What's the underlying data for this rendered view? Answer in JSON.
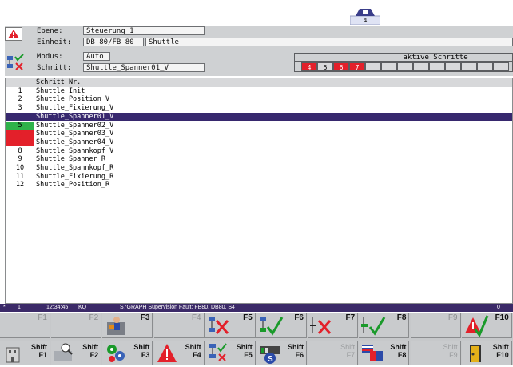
{
  "top_icon": {
    "label": "4"
  },
  "info": {
    "ebene_label": "Ebene:",
    "ebene_value": "Steuerung_1",
    "einheit_label": "Einheit:",
    "einheit_value1": "DB 80/FB 80",
    "einheit_value2": "Shuttle",
    "modus_label": "Modus:",
    "modus_value": "Auto",
    "schritt_label": "Schritt:",
    "schritt_value": "Shuttle_Spanner01_V"
  },
  "active_steps": {
    "title": "aktive Schritte",
    "cells": [
      {
        "label": "4",
        "active": true
      },
      {
        "label": "5",
        "active": false
      },
      {
        "label": "6",
        "active": true
      },
      {
        "label": "7",
        "active": true
      },
      {
        "label": "",
        "active": false
      },
      {
        "label": "",
        "active": false
      },
      {
        "label": "",
        "active": false
      },
      {
        "label": "",
        "active": false
      },
      {
        "label": "",
        "active": false
      },
      {
        "label": "",
        "active": false
      },
      {
        "label": "",
        "active": false
      },
      {
        "label": "",
        "active": false
      },
      {
        "label": "",
        "active": false
      }
    ]
  },
  "list": {
    "header": "Schritt Nr.",
    "rows": [
      {
        "num": "1",
        "name": "Shuttle_Init",
        "state": "normal"
      },
      {
        "num": "2",
        "name": "Shuttle_Position_V",
        "state": "normal"
      },
      {
        "num": "3",
        "name": "Shuttle_Fixierung_V",
        "state": "normal"
      },
      {
        "num": "4",
        "name": "Shuttle_Spanner01_V",
        "state": "selected"
      },
      {
        "num": "5",
        "name": "Shuttle_Spanner02_V",
        "state": "green"
      },
      {
        "num": "6",
        "name": "Shuttle_Spanner03_V",
        "state": "red"
      },
      {
        "num": "7",
        "name": "Shuttle_Spanner04_V",
        "state": "red"
      },
      {
        "num": "8",
        "name": "Shuttle_Spannkopf_V",
        "state": "normal"
      },
      {
        "num": "9",
        "name": "Shuttle_Spanner_R",
        "state": "normal"
      },
      {
        "num": "10",
        "name": "Shuttle_Spannkopf_R",
        "state": "normal"
      },
      {
        "num": "11",
        "name": "Shuttle_Fixierung_R",
        "state": "normal"
      },
      {
        "num": "12",
        "name": "Shuttle_Position_R",
        "state": "normal"
      }
    ]
  },
  "status": {
    "flag": "*",
    "count": "1",
    "time": "12:34:45",
    "code": "KQ",
    "message": "S7GRAPH Supervision Fault: FB80, DB80, S4",
    "right": "0"
  },
  "fkeys_row1": [
    {
      "label": "F1",
      "enabled": false,
      "icon": ""
    },
    {
      "label": "F2",
      "enabled": false,
      "icon": ""
    },
    {
      "label": "F3",
      "enabled": true,
      "icon": "operator-machine-icon"
    },
    {
      "label": "F4",
      "enabled": false,
      "icon": ""
    },
    {
      "label": "F5",
      "enabled": true,
      "icon": "step-cancel-icon"
    },
    {
      "label": "F6",
      "enabled": true,
      "icon": "step-confirm-icon"
    },
    {
      "label": "F7",
      "enabled": true,
      "icon": "transition-cancel-icon"
    },
    {
      "label": "F8",
      "enabled": true,
      "icon": "transition-confirm-icon"
    },
    {
      "label": "F9",
      "enabled": false,
      "icon": ""
    },
    {
      "label": "F10",
      "enabled": true,
      "icon": "alarm-acknowledge-icon"
    }
  ],
  "fkeys_row2": [
    {
      "l1": "Shift",
      "l2": "F1",
      "enabled": true,
      "icon": "building-icon"
    },
    {
      "l1": "Shift",
      "l2": "F2",
      "enabled": true,
      "icon": "zoom-tool-icon"
    },
    {
      "l1": "Shift",
      "l2": "F3",
      "enabled": true,
      "icon": "gears-icon"
    },
    {
      "l1": "Shift",
      "l2": "F4",
      "enabled": true,
      "icon": "warning-icon"
    },
    {
      "l1": "Shift",
      "l2": "F5",
      "enabled": true,
      "icon": "step-structure-icon"
    },
    {
      "l1": "Shift",
      "l2": "F6",
      "enabled": true,
      "icon": "s7-module-icon"
    },
    {
      "l1": "Shift",
      "l2": "F7",
      "enabled": false,
      "icon": ""
    },
    {
      "l1": "Shift",
      "l2": "F8",
      "enabled": true,
      "icon": "language-flags-icon"
    },
    {
      "l1": "Shift",
      "l2": "F9",
      "enabled": false,
      "icon": ""
    },
    {
      "l1": "Shift",
      "l2": "F10",
      "enabled": true,
      "icon": "exit-door-icon"
    }
  ],
  "colors": {
    "selected": "#37286e",
    "green": "#2fb24a",
    "red": "#e3202a",
    "status_bar": "#3b2a68"
  }
}
